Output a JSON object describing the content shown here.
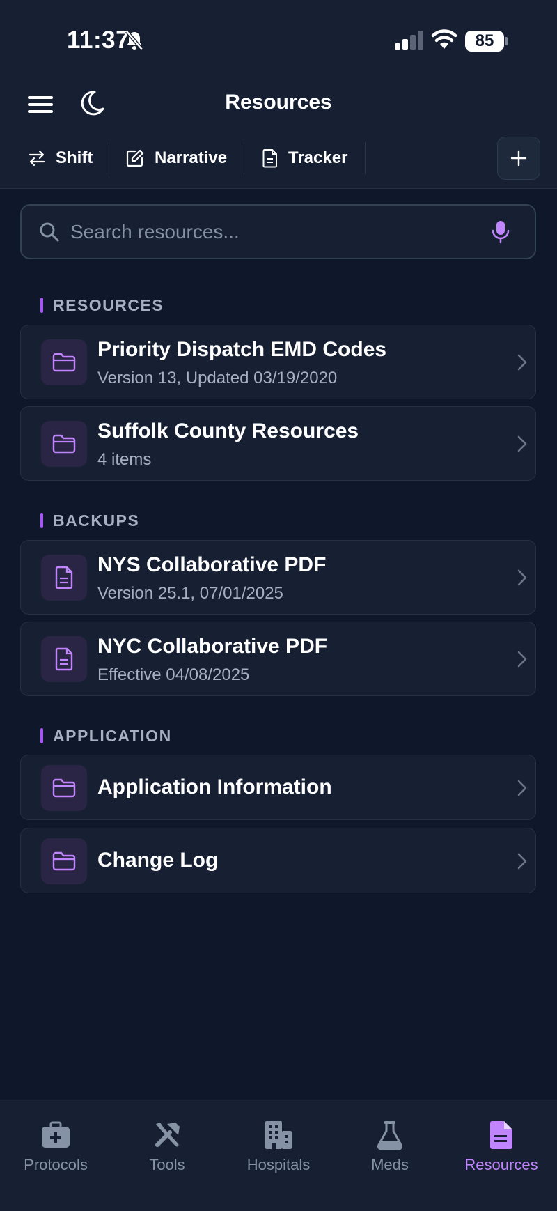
{
  "status_bar": {
    "time": "11:37",
    "battery": "85"
  },
  "header": {
    "title": "Resources"
  },
  "toolbar": {
    "items": [
      {
        "label": "Shift",
        "icon": "swap-arrows-icon"
      },
      {
        "label": "Narrative",
        "icon": "edit-square-icon"
      },
      {
        "label": "Tracker",
        "icon": "document-icon"
      }
    ],
    "add_icon": "plus-icon"
  },
  "search": {
    "placeholder": "Search resources..."
  },
  "sections": [
    {
      "label": "RESOURCES",
      "items": [
        {
          "title": "Priority Dispatch EMD Codes",
          "subtitle": "Version 13, Updated 03/19/2020",
          "icon": "folder-icon"
        },
        {
          "title": "Suffolk County Resources",
          "subtitle": "4 items",
          "icon": "folder-icon"
        }
      ]
    },
    {
      "label": "BACKUPS",
      "items": [
        {
          "title": "NYS Collaborative PDF",
          "subtitle": "Version 25.1, 07/01/2025",
          "icon": "document-icon"
        },
        {
          "title": "NYC Collaborative PDF",
          "subtitle": "Effective 04/08/2025",
          "icon": "document-icon"
        }
      ]
    },
    {
      "label": "APPLICATION",
      "items": [
        {
          "title": "Application Information",
          "icon": "folder-icon"
        },
        {
          "title": "Change Log",
          "icon": "folder-icon"
        }
      ]
    }
  ],
  "tabbar": {
    "tabs": [
      {
        "label": "Protocols",
        "icon": "medkit-icon",
        "active": false
      },
      {
        "label": "Tools",
        "icon": "tools-icon",
        "active": false
      },
      {
        "label": "Hospitals",
        "icon": "building-icon",
        "active": false
      },
      {
        "label": "Meds",
        "icon": "flask-icon",
        "active": false
      },
      {
        "label": "Resources",
        "icon": "document-icon",
        "active": true
      }
    ]
  },
  "colors": {
    "background": "#0f172a",
    "surface": "#172033",
    "accent": "#a855f7",
    "accent_light": "#c084fc",
    "muted_text": "#a6b0c0"
  }
}
